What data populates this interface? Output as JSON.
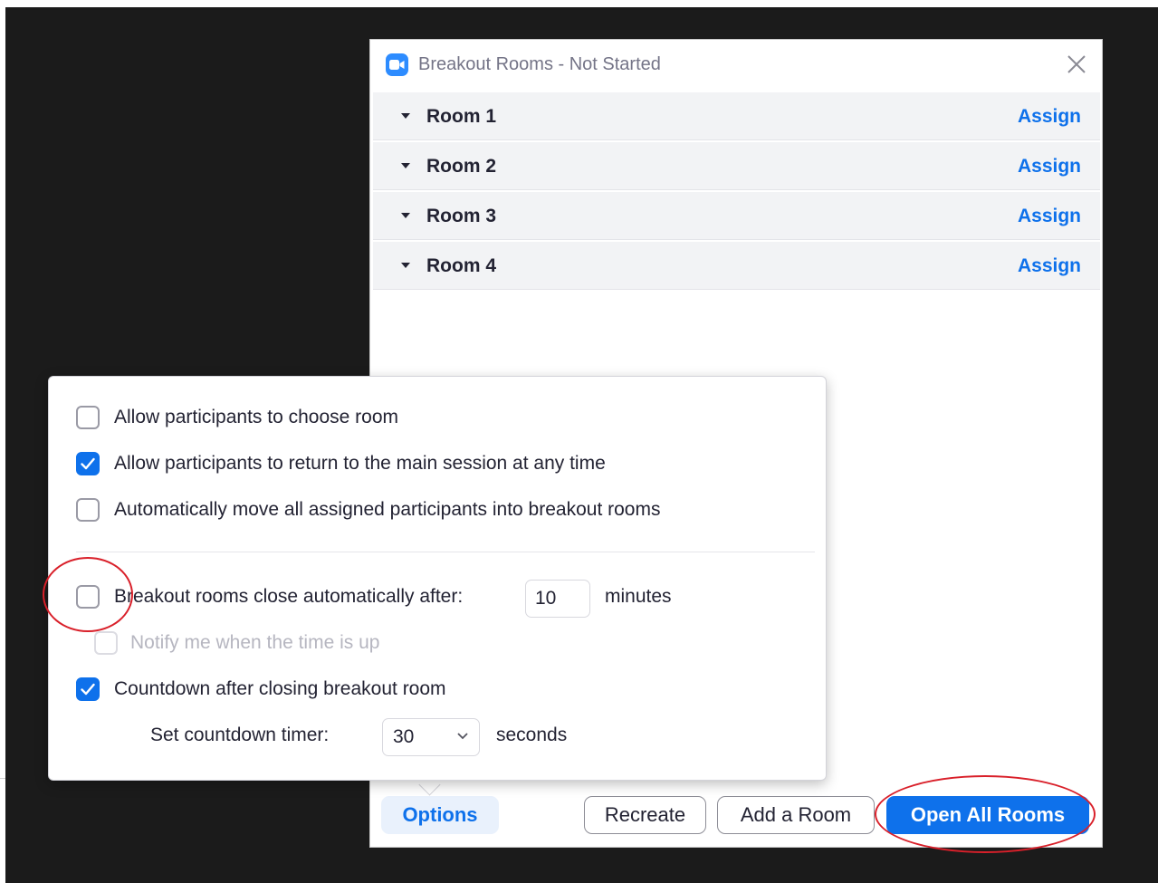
{
  "window": {
    "title": "Breakout Rooms - Not Started",
    "app_icon": "zoom-camera-icon",
    "close_icon": "close-icon"
  },
  "rooms": [
    {
      "name": "Room 1",
      "action": "Assign"
    },
    {
      "name": "Room 2",
      "action": "Assign"
    },
    {
      "name": "Room 3",
      "action": "Assign"
    },
    {
      "name": "Room 4",
      "action": "Assign"
    }
  ],
  "options": {
    "allow_choose": {
      "label": "Allow participants to choose room",
      "checked": false
    },
    "allow_return": {
      "label": "Allow participants to return to the main session at any time",
      "checked": true
    },
    "auto_move": {
      "label": "Automatically move all assigned participants into breakout rooms",
      "checked": false
    },
    "auto_close": {
      "label": "Breakout rooms close automatically after:",
      "checked": false,
      "value": "10",
      "unit": "minutes"
    },
    "notify": {
      "label": "Notify me when the time is up",
      "checked": false,
      "disabled": true
    },
    "countdown": {
      "label": "Countdown after closing breakout room",
      "checked": true
    },
    "countdown_timer": {
      "label": "Set countdown timer:",
      "value": "30",
      "unit": "seconds"
    }
  },
  "footer": {
    "options_label": "Options",
    "recreate_label": "Recreate",
    "add_room_label": "Add a Room",
    "open_all_label": "Open All Rooms"
  },
  "colors": {
    "accent": "#0e71eb",
    "annotation": "#d9202a",
    "backdrop": "#1b1b1b"
  }
}
